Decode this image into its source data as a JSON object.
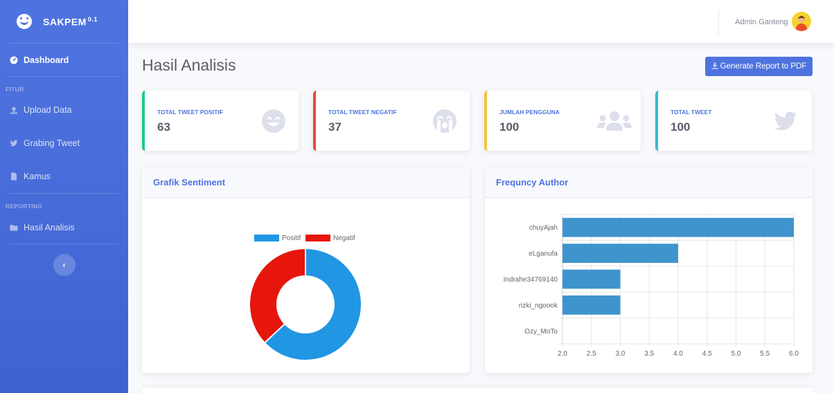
{
  "sidebar": {
    "brand": "SAKPEM",
    "version": "0.1",
    "items": [
      {
        "label": "Dashboard"
      },
      {
        "label": "Upload Data"
      },
      {
        "label": "Grabing Tweet"
      },
      {
        "label": "Kamus"
      },
      {
        "label": "Hasil Analisis"
      }
    ],
    "headings": [
      "FITUR",
      "REPORTING"
    ],
    "toggle_icon": "chevron-left-icon"
  },
  "topbar": {
    "user_name": "Admin Ganteng"
  },
  "page": {
    "title": "Hasil Analisis",
    "report_button": "Generate Report to PDF"
  },
  "stats": [
    {
      "label": "TOTAL TWEET POSITIF",
      "value": "63",
      "color": "#1cc88a",
      "icon": "smile-icon"
    },
    {
      "label": "TOTAL TWEET NEGATIF",
      "value": "37",
      "color": "#e74a3b",
      "icon": "sad-tear-icon"
    },
    {
      "label": "JUMLAH PENGGUNA",
      "value": "100",
      "color": "#f6c23e",
      "icon": "users-icon"
    },
    {
      "label": "TOTAL TWEET",
      "value": "100",
      "color": "#36b9cc",
      "icon": "twitter-icon"
    }
  ],
  "panels": {
    "sentiment_title": "Grafik Sentiment",
    "author_title": "Frequncy Author"
  },
  "chart_data": [
    {
      "type": "pie",
      "variant": "doughnut",
      "labels": [
        "Positif",
        "Negatif"
      ],
      "values": [
        63,
        37
      ],
      "colors": [
        "#2196e3",
        "#e6160d"
      ],
      "legend": "top"
    },
    {
      "type": "bar",
      "orientation": "horizontal",
      "categories": [
        "chuyAjah",
        "eLganufa",
        "Indrahe34769140",
        "rizki_ngoook",
        "Ozy_MoTo"
      ],
      "values": [
        6,
        4,
        3,
        3,
        2
      ],
      "xlim": [
        2.0,
        6.0
      ],
      "ticks": [
        "2.0",
        "2.5",
        "3.0",
        "3.5",
        "4.0",
        "4.5",
        "5.0",
        "5.5",
        "6.0"
      ],
      "color": "#3e95cd",
      "grid": true
    }
  ]
}
